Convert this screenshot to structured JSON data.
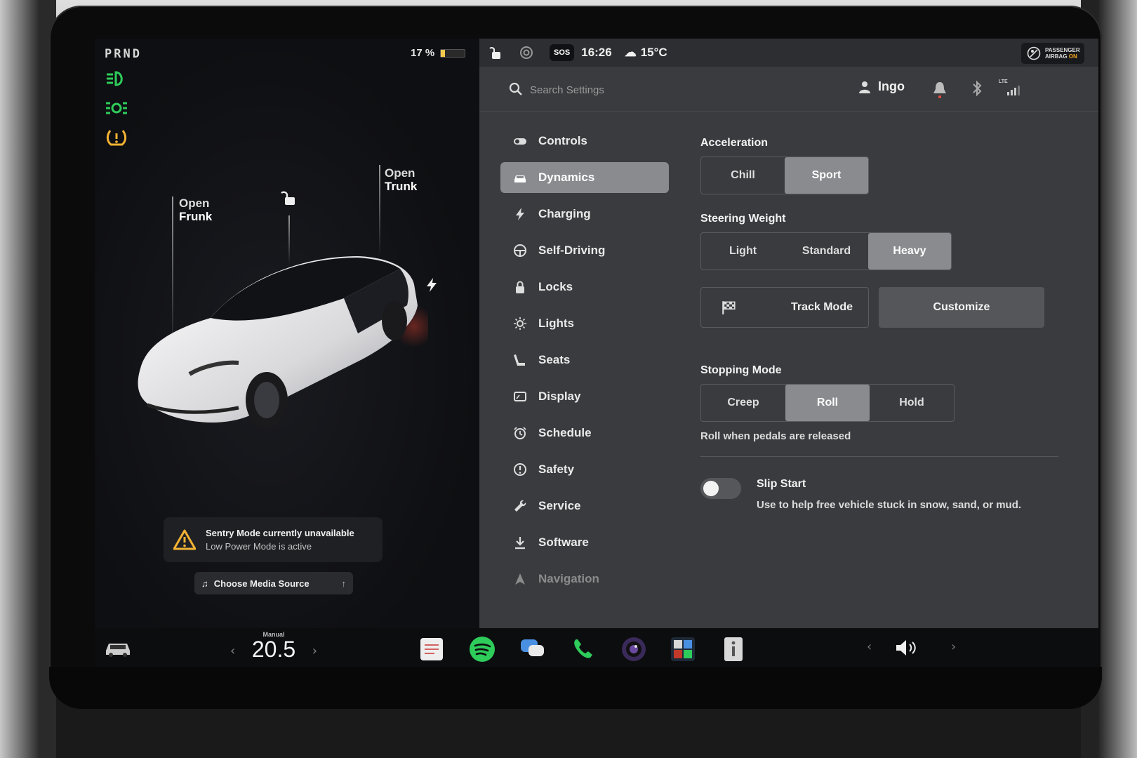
{
  "gear": "PRND",
  "battery": {
    "label": "17 %",
    "level": 0.17
  },
  "callouts": {
    "frunk": {
      "line1": "Open",
      "line2": "Frunk"
    },
    "trunk": {
      "line1": "Open",
      "line2": "Trunk"
    }
  },
  "alerts": {
    "sentry_title": "Sentry Mode currently unavailable",
    "sentry_sub": "Low Power Mode is active"
  },
  "media": {
    "choose_label": "Choose Media Source"
  },
  "status": {
    "sos_label": "SOS",
    "time": "16:26",
    "temperature": "15°C",
    "airbag_line1": "PASSENGER",
    "airbag_line2": "AIRBAG",
    "airbag_state": "ON"
  },
  "search": {
    "placeholder": "Search Settings"
  },
  "user": {
    "name": "Ingo"
  },
  "signal": {
    "network": "LTE"
  },
  "nav": {
    "items": [
      {
        "label": "Controls",
        "icon": "toggle-icon"
      },
      {
        "label": "Dynamics",
        "icon": "car-icon",
        "active": true
      },
      {
        "label": "Charging",
        "icon": "bolt-icon"
      },
      {
        "label": "Self-Driving",
        "icon": "steering-wheel-icon"
      },
      {
        "label": "Locks",
        "icon": "lock-icon"
      },
      {
        "label": "Lights",
        "icon": "sun-icon"
      },
      {
        "label": "Seats",
        "icon": "seat-icon"
      },
      {
        "label": "Display",
        "icon": "display-icon"
      },
      {
        "label": "Schedule",
        "icon": "alarm-clock-icon"
      },
      {
        "label": "Safety",
        "icon": "alert-circle-icon"
      },
      {
        "label": "Service",
        "icon": "wrench-icon"
      },
      {
        "label": "Software",
        "icon": "download-icon"
      },
      {
        "label": "Navigation",
        "icon": "navigation-arrow-icon"
      }
    ]
  },
  "dynamics": {
    "acceleration": {
      "title": "Acceleration",
      "options": [
        "Chill",
        "Sport"
      ],
      "selected": "Sport"
    },
    "steering": {
      "title": "Steering Weight",
      "options": [
        "Light",
        "Standard",
        "Heavy"
      ],
      "selected": "Heavy"
    },
    "track_mode_label": "Track Mode",
    "customize_label": "Customize",
    "stopping": {
      "title": "Stopping Mode",
      "options": [
        "Creep",
        "Roll",
        "Hold"
      ],
      "selected": "Roll",
      "helper": "Roll when pedals are released"
    },
    "slip_start": {
      "title": "Slip Start",
      "description": "Use to help free vehicle stuck in snow, sand, or mud.",
      "enabled": false
    }
  },
  "climate": {
    "mode": "Manual",
    "temperature": "20.5"
  },
  "colors": {
    "accent_green": "#2ecc5a",
    "warning_amber": "#f2b233",
    "selected_gray": "#8a8b8f",
    "panel_gray": "#3a3b3f"
  }
}
